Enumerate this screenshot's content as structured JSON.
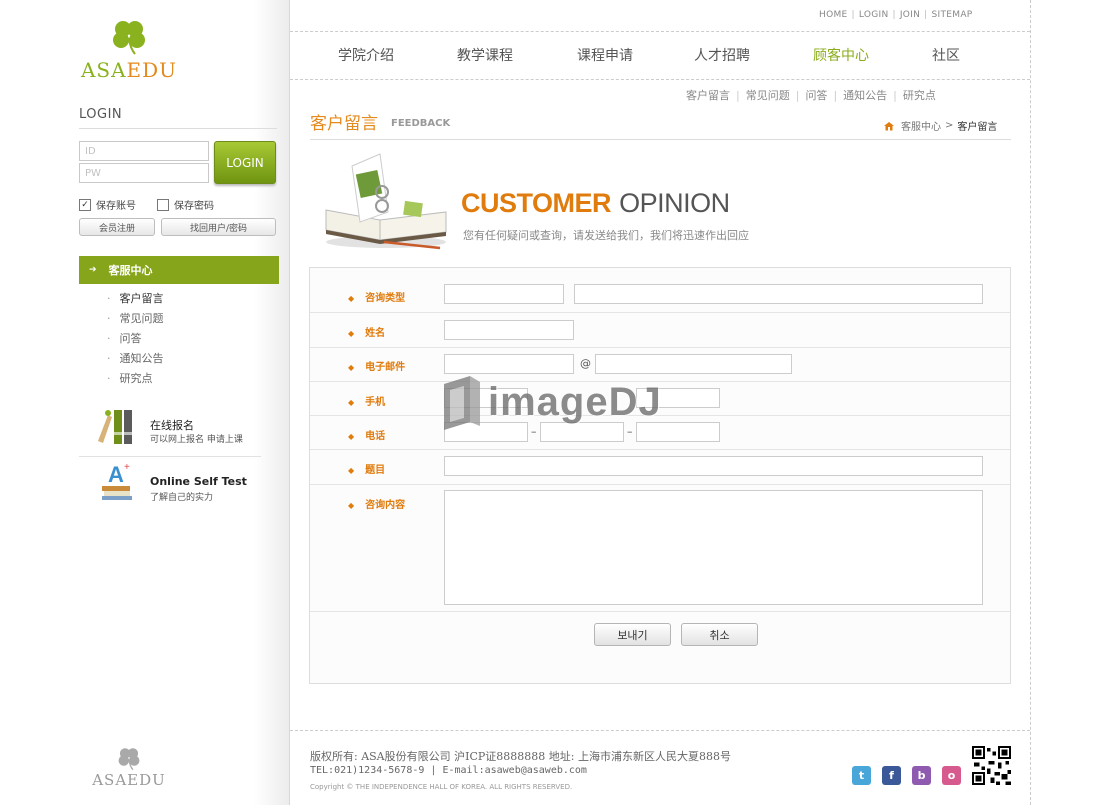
{
  "brand": {
    "name_part1": "ASA",
    "name_part2": "EDU",
    "footer_name": "ASAEDU"
  },
  "top_links": [
    "HOME",
    "LOGIN",
    "JOIN",
    "SITEMAP"
  ],
  "gnb": [
    {
      "label": "学院介绍",
      "active": false
    },
    {
      "label": "教学课程",
      "active": false
    },
    {
      "label": "课程申请",
      "active": false
    },
    {
      "label": "人才招聘",
      "active": false
    },
    {
      "label": "顾客中心",
      "active": true
    },
    {
      "label": "社区",
      "active": false
    }
  ],
  "login": {
    "title": "LOGIN",
    "id_placeholder": "ID",
    "pw_placeholder": "PW",
    "button": "LOGIN",
    "save_id": "保存账号",
    "save_id_checked": true,
    "save_pw": "保存密码",
    "save_pw_checked": false,
    "register": "会员注册",
    "find": "找回用户/密码"
  },
  "side_menu": {
    "title": "客服中心",
    "items": [
      "客户留言",
      "常见问题",
      "问答",
      "通知公告",
      "研究点"
    ]
  },
  "promos": {
    "apply": {
      "title": "在线报名",
      "subtitle": "可以网上报名 申请上课"
    },
    "test": {
      "title": "Online Self Test",
      "subtitle": "了解自己的实力"
    }
  },
  "sub_links": [
    "客户留言",
    "常见问题",
    "问答",
    "通知公告",
    "研究点"
  ],
  "page": {
    "title": "客户留言",
    "title_en": "FEEDBACK",
    "breadcrumb": [
      "客服中心",
      "客户留言"
    ]
  },
  "banner": {
    "title_bold": "CUSTOMER",
    "title_light": "OPINION",
    "subtitle": "您有任何疑问或查询，请发送给我们，我们将迅速作出回应"
  },
  "form": {
    "labels": {
      "type": "咨询类型",
      "name": "姓名",
      "email": "电子邮件",
      "mobile": "手机",
      "phone": "电话",
      "subject": "题目",
      "content": "咨询内容"
    },
    "at": "@",
    "dash": "–",
    "send": "보내기",
    "cancel": "취소"
  },
  "watermark": "imageDJ",
  "footer": {
    "line1": "版权所有: ASA股份有限公司 沪ICP证8888888 地址: 上海市浦东新区人民大夏888号",
    "line2": "TEL:021)1234-5678-9 | E-mail:asaweb@asaweb.com",
    "copyright": "Copyright © THE INDEPENDENCE HALL OF KOREA. ALL RIGHTS RESERVED."
  },
  "sns": [
    "t",
    "f",
    "b",
    "o"
  ],
  "colors": {
    "accent_green": "#86a51b",
    "accent_orange": "#e07c0e"
  }
}
